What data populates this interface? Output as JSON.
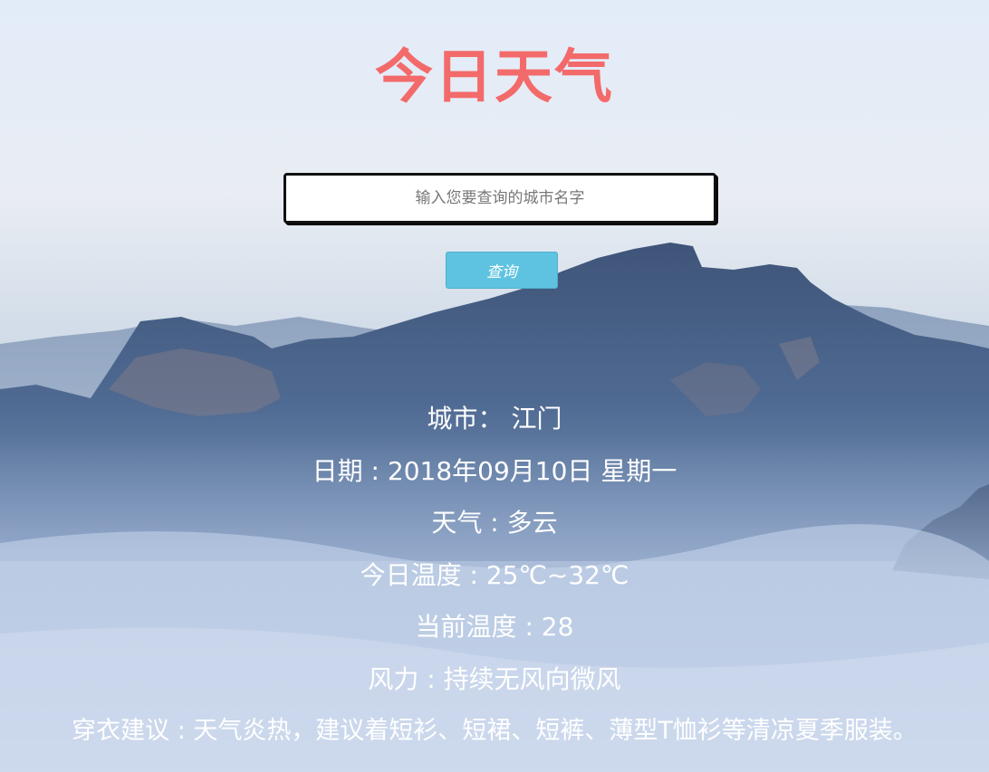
{
  "header": {
    "title": "今日天气"
  },
  "search": {
    "placeholder": "输入您要查询的城市名字",
    "button_label": "查询"
  },
  "weather": {
    "city_label": "城市：",
    "city_value": "江门",
    "date_label": "日期 : ",
    "date_value": "2018年09月10日 星期一",
    "weather_label": "天气 : ",
    "weather_value": "多云",
    "temp_range_label": "今日温度 : ",
    "temp_range_value": "25℃~32℃",
    "current_temp_label": "当前温度 : ",
    "current_temp_value": "28",
    "wind_label": "风力 : ",
    "wind_value": "持续无风向微风",
    "clothing_label": "穿衣建议 : ",
    "clothing_value": "天气炎热，建议着短衫、短裙、短裤、薄型T恤衫等清凉夏季服装。"
  },
  "colors": {
    "title": "#f36a6a",
    "button": "#5ec3e0",
    "info_text": "#ffffff"
  }
}
